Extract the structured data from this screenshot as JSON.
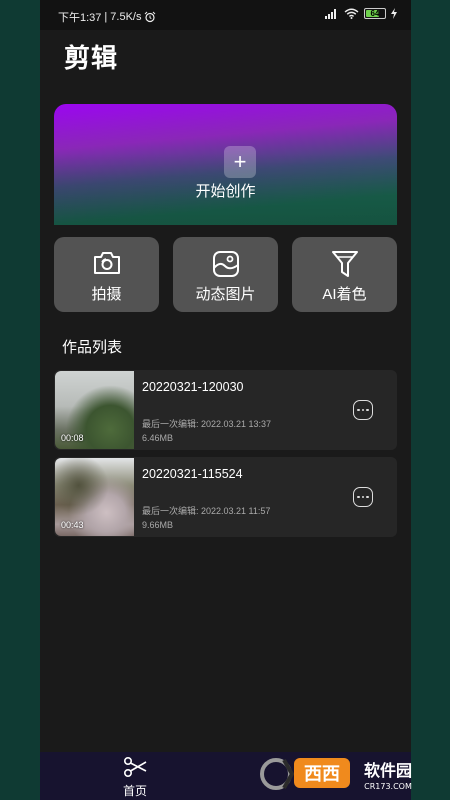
{
  "status_bar": {
    "time": "下午1:37",
    "speed": "7.5K/s",
    "battery": "64"
  },
  "page_title": "剪辑",
  "hero": {
    "plus": "+",
    "label": "开始创作"
  },
  "tools": [
    {
      "label": "拍摄",
      "icon": "camera-icon"
    },
    {
      "label": "动态图片",
      "icon": "image-icon"
    },
    {
      "label": "AI着色",
      "icon": "filter-icon"
    }
  ],
  "section_title": "作品列表",
  "works": [
    {
      "name": "20220321-120030",
      "edited": "最后一次编辑: 2022.03.21 13:37",
      "size": "6.46MB",
      "duration": "00:08"
    },
    {
      "name": "20220321-115524",
      "edited": "最后一次编辑: 2022.03.21 11:57",
      "size": "9.66MB",
      "duration": "00:43"
    }
  ],
  "bottom_nav": [
    {
      "label": "首页",
      "icon": "scissors-icon"
    }
  ],
  "watermark": {
    "text1": "西西软件园",
    "text2": "CR173.COM"
  },
  "colors": {
    "card": "#535353",
    "background": "#1a1a1a",
    "list_item": "#262626",
    "nav": "#17132f"
  }
}
